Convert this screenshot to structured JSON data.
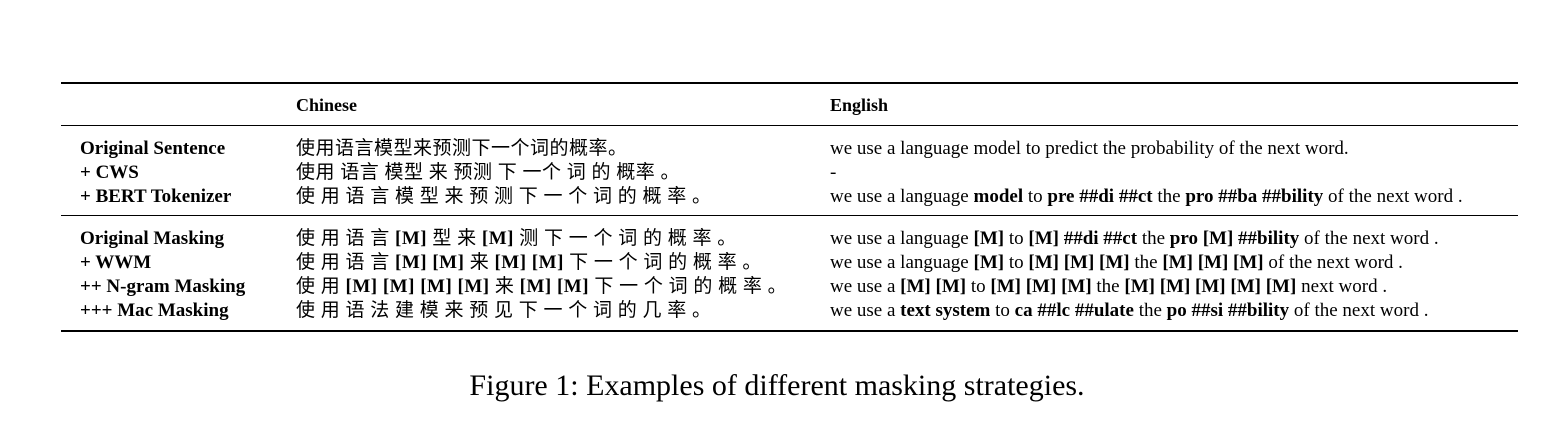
{
  "table": {
    "headers": [
      "",
      "Chinese",
      "English"
    ],
    "groups": [
      {
        "rows": [
          {
            "label": "Original Sentence",
            "chinese": [
              {
                "t": "使用语言模型来预测下一个词的概率。",
                "b": false
              }
            ],
            "english": [
              {
                "t": "we use a language model to predict the probability of the next word.",
                "b": false
              }
            ]
          },
          {
            "label": "+ CWS",
            "chinese": [
              {
                "t": "使用 语言 模型 来 预测 下 一个 词 的 概率 。",
                "b": false
              }
            ],
            "english": [
              {
                "t": "-",
                "b": false
              }
            ]
          },
          {
            "label": "+ BERT Tokenizer",
            "chinese": [
              {
                "t": "使 用 语 言 模 型 来 预 测 下 一 个 词 的 概 率 。",
                "b": false
              }
            ],
            "english": [
              {
                "t": "we use a language ",
                "b": false
              },
              {
                "t": "model",
                "b": true
              },
              {
                "t": " to ",
                "b": false
              },
              {
                "t": "pre ##di ##ct",
                "b": true
              },
              {
                "t": " the ",
                "b": false
              },
              {
                "t": "pro ##ba ##bility",
                "b": true
              },
              {
                "t": " of the next word .",
                "b": false
              }
            ]
          }
        ]
      },
      {
        "rows": [
          {
            "label": "Original Masking",
            "chinese": [
              {
                "t": "使 用 语 言 ",
                "b": false
              },
              {
                "t": "[M]",
                "b": true
              },
              {
                "t": " 型 来 ",
                "b": false
              },
              {
                "t": "[M]",
                "b": true
              },
              {
                "t": " 测 下 一 个 词 的 概 率 。",
                "b": false
              }
            ],
            "english": [
              {
                "t": "we use a language ",
                "b": false
              },
              {
                "t": "[M]",
                "b": true
              },
              {
                "t": " to ",
                "b": false
              },
              {
                "t": "[M] ##di ##ct",
                "b": true
              },
              {
                "t": " the ",
                "b": false
              },
              {
                "t": "pro [M] ##bility",
                "b": true
              },
              {
                "t": " of the next word .",
                "b": false
              }
            ]
          },
          {
            "label": "+ WWM",
            "chinese": [
              {
                "t": "使 用 语 言 ",
                "b": false
              },
              {
                "t": "[M] [M]",
                "b": true
              },
              {
                "t": " 来 ",
                "b": false
              },
              {
                "t": "[M] [M]",
                "b": true
              },
              {
                "t": " 下 一 个 词 的 概 率 。",
                "b": false
              }
            ],
            "english": [
              {
                "t": "we use a language ",
                "b": false
              },
              {
                "t": "[M]",
                "b": true
              },
              {
                "t": " to ",
                "b": false
              },
              {
                "t": "[M] [M] [M]",
                "b": true
              },
              {
                "t": " the ",
                "b": false
              },
              {
                "t": "[M] [M] [M]",
                "b": true
              },
              {
                "t": " of the next word .",
                "b": false
              }
            ]
          },
          {
            "label": "++ N-gram Masking",
            "chinese": [
              {
                "t": "使 用 ",
                "b": false
              },
              {
                "t": "[M] [M] [M] [M]",
                "b": true
              },
              {
                "t": " 来 ",
                "b": false
              },
              {
                "t": "[M] [M]",
                "b": true
              },
              {
                "t": " 下 一 个 词 的 概 率 。",
                "b": false
              }
            ],
            "english": [
              {
                "t": "we use a ",
                "b": false
              },
              {
                "t": "[M] [M]",
                "b": true
              },
              {
                "t": " to ",
                "b": false
              },
              {
                "t": "[M] [M] [M]",
                "b": true
              },
              {
                "t": " the ",
                "b": false
              },
              {
                "t": "[M] [M] [M] [M] [M]",
                "b": true
              },
              {
                "t": " next word .",
                "b": false
              }
            ]
          },
          {
            "label": "+++ Mac Masking",
            "chinese": [
              {
                "t": "使 用 语 法 建 模 来 预 见 下 一 个 词 的 几 率 。",
                "b": false
              }
            ],
            "english": [
              {
                "t": "we use a ",
                "b": false
              },
              {
                "t": "text system",
                "b": true
              },
              {
                "t": " to ",
                "b": false
              },
              {
                "t": "ca ##lc ##ulate",
                "b": true
              },
              {
                "t": " the ",
                "b": false
              },
              {
                "t": "po ##si ##bility",
                "b": true
              },
              {
                "t": " of the next word .",
                "b": false
              }
            ]
          }
        ]
      }
    ]
  },
  "caption": "Figure 1:  Examples of different masking strategies."
}
